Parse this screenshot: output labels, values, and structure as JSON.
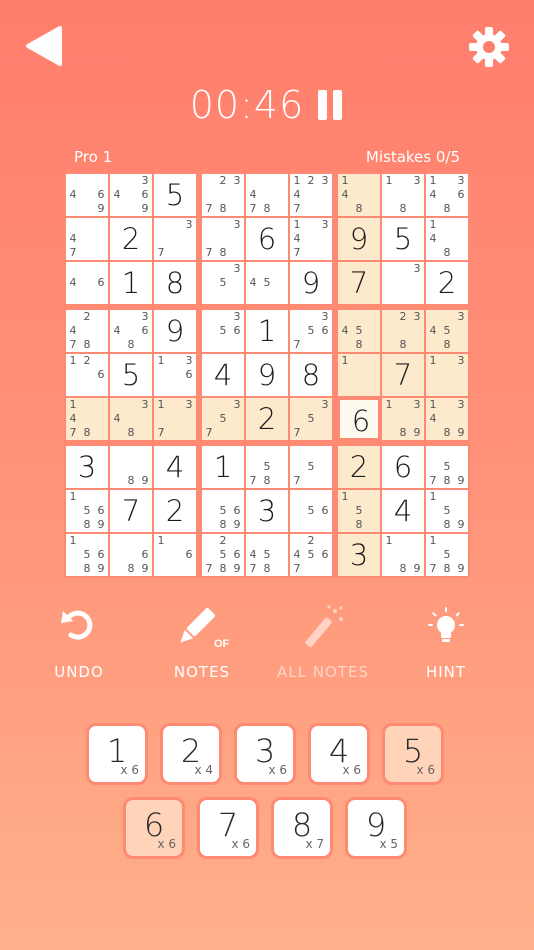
{
  "header": {
    "back_icon": "back-triangle-icon",
    "settings_icon": "gear-icon",
    "timer": "00:46",
    "pause_icon": "pause-icon"
  },
  "level_label": "Pro 1",
  "mistakes_label": "Mistakes 0/5",
  "colors": {
    "accent": "#ff8a74",
    "highlight": "#fde9cc",
    "active_number": "#ffd4b9"
  },
  "board": {
    "selected": [
      5,
      6
    ],
    "highlighted": [
      [
        0,
        6
      ],
      [
        1,
        6
      ],
      [
        2,
        6
      ],
      [
        3,
        6
      ],
      [
        4,
        6
      ],
      [
        5,
        6
      ],
      [
        6,
        6
      ],
      [
        7,
        6
      ],
      [
        8,
        6
      ],
      [
        5,
        0
      ],
      [
        5,
        1
      ],
      [
        5,
        2
      ],
      [
        5,
        3
      ],
      [
        5,
        4
      ],
      [
        5,
        5
      ],
      [
        5,
        7
      ],
      [
        5,
        8
      ],
      [
        3,
        7
      ],
      [
        3,
        8
      ],
      [
        4,
        7
      ],
      [
        4,
        8
      ]
    ],
    "values": [
      [
        0,
        0,
        5,
        0,
        0,
        0,
        0,
        0,
        0
      ],
      [
        0,
        2,
        0,
        0,
        6,
        0,
        9,
        5,
        0
      ],
      [
        0,
        1,
        8,
        0,
        0,
        9,
        7,
        0,
        2
      ],
      [
        0,
        0,
        9,
        0,
        1,
        0,
        0,
        0,
        0
      ],
      [
        0,
        5,
        0,
        4,
        9,
        8,
        0,
        7,
        0
      ],
      [
        0,
        0,
        0,
        0,
        2,
        0,
        6,
        0,
        0
      ],
      [
        3,
        0,
        4,
        1,
        0,
        0,
        2,
        6,
        0
      ],
      [
        0,
        7,
        2,
        0,
        3,
        0,
        0,
        4,
        0
      ],
      [
        0,
        0,
        0,
        0,
        0,
        0,
        3,
        0,
        0
      ]
    ],
    "notes": [
      [
        "469",
        "3469",
        "",
        "0023078",
        "478",
        "123047",
        "14008",
        "1308",
        "13468"
      ],
      [
        "47",
        "",
        "307",
        "3078",
        "",
        "1347",
        "",
        "",
        "1408"
      ],
      [
        "406",
        "",
        "",
        "30500",
        "405",
        "",
        "",
        "3",
        ""
      ],
      [
        "2478",
        "3468",
        "",
        "356000",
        "",
        "356007",
        "4508",
        "23008",
        "3458"
      ],
      [
        "126",
        "",
        "136",
        "",
        "",
        "",
        "1",
        "",
        "13"
      ],
      [
        "1478",
        "348",
        "137",
        "357",
        "",
        "357",
        "",
        "13089",
        "13489"
      ],
      [
        "",
        "89",
        "",
        "",
        "578",
        "57",
        "",
        "",
        "5789"
      ],
      [
        "15689",
        "",
        "",
        "5689",
        "",
        "56",
        "158",
        "",
        "1589"
      ],
      [
        "15689",
        "0006089",
        "16",
        "256789",
        "4578",
        "24567",
        "",
        "189",
        "15789"
      ]
    ]
  },
  "tools": [
    {
      "label": "UNDO",
      "icon": "undo-icon"
    },
    {
      "label": "NOTES",
      "icon": "pencil-icon",
      "badge": "OFF"
    },
    {
      "label": "ALL NOTES",
      "icon": "magic-wand-icon"
    },
    {
      "label": "HINT",
      "icon": "lightbulb-icon"
    }
  ],
  "numpad": [
    {
      "digit": "1",
      "count": "x 6"
    },
    {
      "digit": "2",
      "count": "x 4"
    },
    {
      "digit": "3",
      "count": "x 6"
    },
    {
      "digit": "4",
      "count": "x 6"
    },
    {
      "digit": "5",
      "count": "x 6"
    },
    {
      "digit": "6",
      "count": "x 6"
    },
    {
      "digit": "7",
      "count": "x 6"
    },
    {
      "digit": "8",
      "count": "x 7"
    },
    {
      "digit": "9",
      "count": "x 5"
    }
  ],
  "active_numbers": [
    "5",
    "6"
  ]
}
